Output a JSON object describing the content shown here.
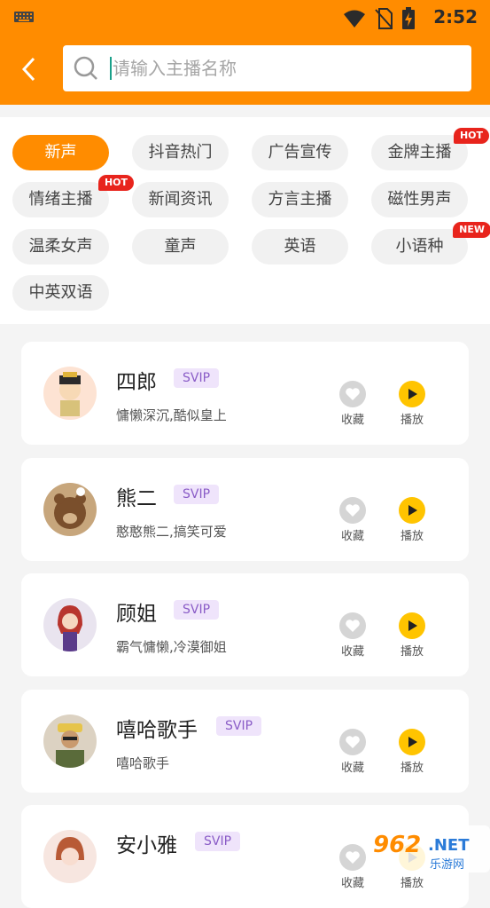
{
  "status": {
    "time": "2:52"
  },
  "search": {
    "placeholder": "请输入主播名称"
  },
  "tags": [
    {
      "label": "新声",
      "active": true
    },
    {
      "label": "抖音热门"
    },
    {
      "label": "广告宣传"
    },
    {
      "label": "金牌主播",
      "badge": "HOT"
    },
    {
      "label": "情绪主播",
      "badge": "HOT"
    },
    {
      "label": "新闻资讯"
    },
    {
      "label": "方言主播"
    },
    {
      "label": "磁性男声"
    },
    {
      "label": "温柔女声"
    },
    {
      "label": "童声"
    },
    {
      "label": "英语"
    },
    {
      "label": "小语种",
      "badge": "NEW"
    },
    {
      "label": "中英双语"
    }
  ],
  "anchors": [
    {
      "name": "四郎",
      "badge": "SVIP",
      "desc": "慵懒深沉,酷似皇上",
      "fav": "收藏",
      "play": "播放"
    },
    {
      "name": "熊二",
      "badge": "SVIP",
      "desc": "憨憨熊二,搞笑可爱",
      "fav": "收藏",
      "play": "播放"
    },
    {
      "name": "顾姐",
      "badge": "SVIP",
      "desc": "霸气慵懒,冷漠御姐",
      "fav": "收藏",
      "play": "播放"
    },
    {
      "name": "嘻哈歌手",
      "badge": "SVIP",
      "desc": "嘻哈歌手",
      "fav": "收藏",
      "play": "播放"
    },
    {
      "name": "安小雅",
      "badge": "SVIP",
      "desc": "",
      "fav": "收藏",
      "play": "播放"
    }
  ],
  "watermark": {
    "main": "962",
    "suffix": ".NET",
    "sub": "乐游网"
  },
  "colors": {
    "accent": "#ff8c00",
    "play": "#ffc400",
    "hot": "#e8241c"
  }
}
